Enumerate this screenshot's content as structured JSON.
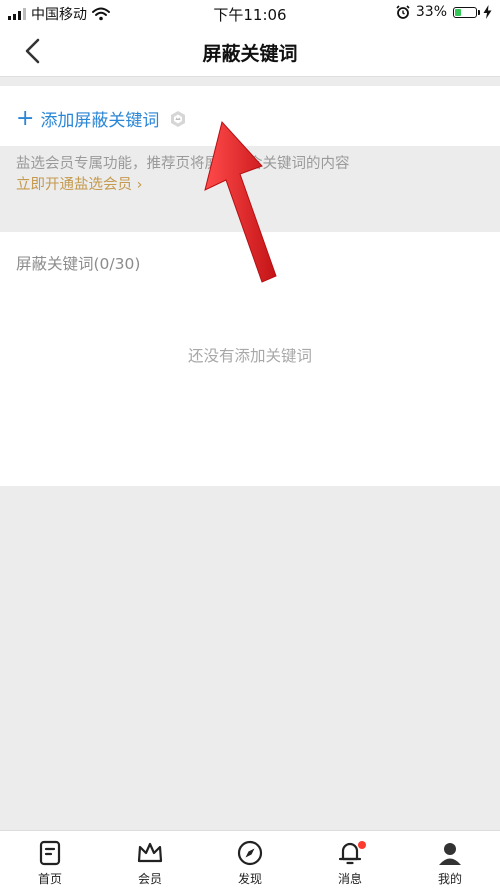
{
  "status_bar": {
    "carrier": "中国移动",
    "time": "下午11:06",
    "battery": "33%",
    "battery_level": 0.33,
    "battery_color": "#34c759"
  },
  "nav": {
    "title": "屏蔽关键词",
    "back_icon": "chevron-left-icon"
  },
  "add": {
    "plus": "+",
    "label": "添加屏蔽关键词",
    "badge_icon": "vip-hexagon-icon"
  },
  "vip_note": {
    "description": "盐选会员专属功能，推荐页将屏蔽包含关键词的内容",
    "link": "立即开通盐选会员 ›"
  },
  "keyword_list": {
    "header": "屏蔽关键词(0/30)",
    "empty_text": "还没有添加关键词",
    "items": []
  },
  "tabbar": {
    "items": [
      {
        "label": "首页",
        "icon": "home-doc-icon"
      },
      {
        "label": "会员",
        "icon": "crown-icon"
      },
      {
        "label": "发现",
        "icon": "compass-icon"
      },
      {
        "label": "消息",
        "icon": "bell-icon",
        "has_dot": true
      },
      {
        "label": "我的",
        "icon": "avatar-icon"
      }
    ]
  },
  "colors": {
    "accent": "#2a86d6",
    "vip_gold": "#c49a4e",
    "arrow": "#e8282b",
    "notification_dot": "#ff3b30"
  }
}
